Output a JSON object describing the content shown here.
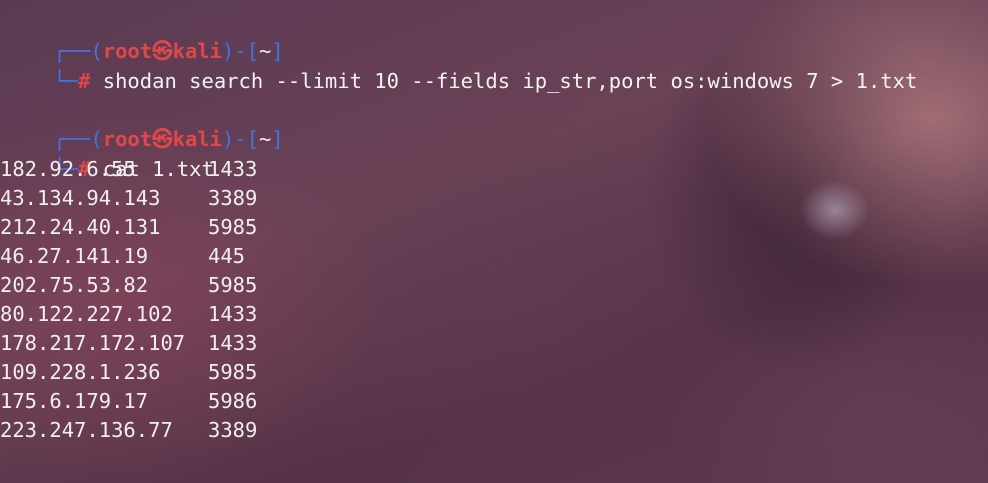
{
  "prompt": {
    "top_open": "┌──(",
    "user": "root",
    "separator": "㉿",
    "host": "kali",
    "mid": ")-[",
    "dir": "~",
    "close": "]",
    "bottom": "└─",
    "symbol": "#"
  },
  "commands": [
    {
      "text": "shodan search --limit 10 --fields ip_str,port os:windows 7 > 1.txt"
    },
    {
      "text": "cat 1.txt"
    }
  ],
  "output_rows": [
    {
      "ip": "182.92.6.55",
      "port": "1433"
    },
    {
      "ip": "43.134.94.143",
      "port": "3389"
    },
    {
      "ip": "212.24.40.131",
      "port": "5985"
    },
    {
      "ip": "46.27.141.19",
      "port": "445"
    },
    {
      "ip": "202.75.53.82",
      "port": "5985"
    },
    {
      "ip": "80.122.227.102",
      "port": "1433"
    },
    {
      "ip": "178.217.172.107",
      "port": "1433"
    },
    {
      "ip": "109.228.1.236",
      "port": "5985"
    },
    {
      "ip": "175.6.179.17",
      "port": "5986"
    },
    {
      "ip": "223.247.136.77",
      "port": "3389"
    }
  ],
  "colors": {
    "prompt_frame": "#3d74e8",
    "prompt_user_host": "#e04848",
    "text": "#efefef"
  }
}
